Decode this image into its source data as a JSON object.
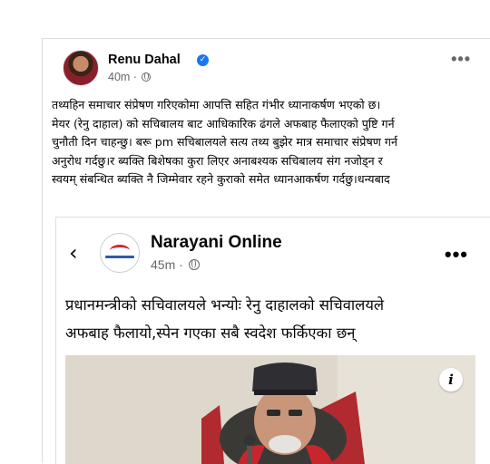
{
  "post": {
    "author": "Renu Dahal",
    "time": "40m",
    "more_label": "•••",
    "verified_symbol": "✓",
    "text_lines": [
      "तथ्यहिन समाचार संप्रेषण गरिएकोमा आपत्ति सहित गंभीर ध्यानाकर्षण भएको छ।",
      "मेयर (रेनु दाहाल) को सचिबालय बाट आधिकारिक ढंगले अफबाह फैलाएको पुष्टि गर्न",
      "चुनौती दिन चाहन्छु। बरू pm सचिबालयले सत्य तथ्य बुझेर मात्र समाचार संप्रेषण गर्न",
      "अनुरोध गर्दछु।र ब्यक्ति बिशेषका कुरा लिएर अनाबश्यक सचिबालय संग नजोड्न र",
      "स्वयम् संबन्धित ब्यक्ति नै जिम्मेवार रहने कुराको समेत ध्यानआकर्षण गर्दछु।धन्यबाद"
    ]
  },
  "shared": {
    "back_symbol": "‹",
    "page_name": "Narayani Online",
    "time": "45m",
    "more_label": "•••",
    "headline_lines": [
      "प्रधानमन्त्रीको सचिवालयले भन्योः रेनु दाहालको सचिवालयले",
      "अफबाह फैलायो,स्पेन गएका सबै स्वदेश फर्किएका छन्"
    ],
    "info_symbol": "i"
  },
  "colors": {
    "link_blue": "#1877f2",
    "meta_gray": "#65676b",
    "text": "#050505"
  },
  "icons": [
    "globe-icon",
    "verified-badge-icon",
    "back-icon",
    "more-icon",
    "info-icon"
  ]
}
